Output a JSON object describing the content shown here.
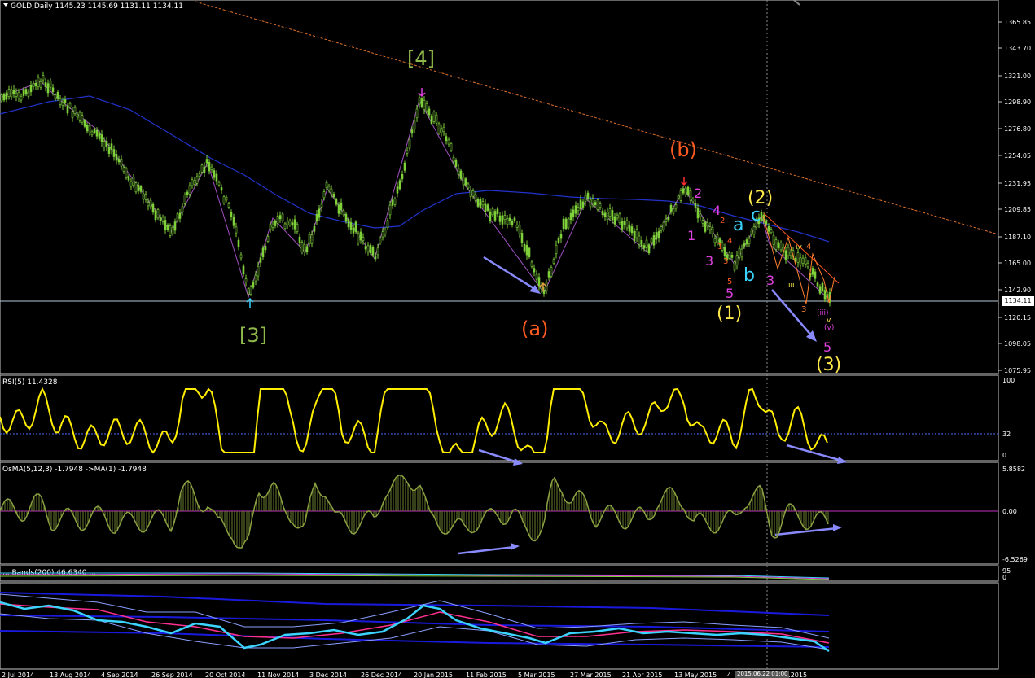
{
  "symbol_title": "GOLD,Daily  1145.23 1145.69 1131.11 1134.11",
  "current_price_label": "1134.11",
  "crosshair_date_label": "2015.06.22 01:00",
  "price_scale": [
    "1365.85",
    "1343.70",
    "1321.00",
    "1298.90",
    "1276.80",
    "1254.05",
    "1231.95",
    "1209.85",
    "1187.10",
    "1165.00",
    "1142.90",
    "1120.15",
    "1098.05",
    "1075.95"
  ],
  "rsi": {
    "title": "RSI(5) 11.4328",
    "scale": [
      "100",
      "32",
      "0"
    ]
  },
  "osma": {
    "title": "OsMA(5,12,3) -1.7948   ->MA(1) -1.7948",
    "scale": [
      "5.8582",
      "0.00",
      "-6.5269"
    ]
  },
  "strip": {
    "title": "... Bands(200) 46.6340 ...",
    "scale": [
      "95",
      "0"
    ]
  },
  "date_axis": [
    "2 Jul 2014",
    "13 Aug 2014",
    "4 Sep 2014",
    "26 Sep 2014",
    "20 Oct 2014",
    "11 Nov 2014",
    "3 Dec 2014",
    "26 Dec 2014",
    "20 Jan 2015",
    "11 Feb 2015",
    "5 Mar 2015",
    "27 Mar 2015",
    "21 Apr 2015",
    "13 May 2015",
    "4",
    "1 ..2015"
  ],
  "wave_labels": {
    "w3": "[3]",
    "w4": "[4]",
    "a": "(a)",
    "b": "(b)",
    "one": "(1)",
    "two": "(2)",
    "three": "(3)",
    "m1": "1",
    "m2": "2",
    "m3": "3",
    "m4": "4",
    "m5": "5",
    "sa": "a",
    "sb": "b",
    "sc": "c",
    "m3b": "3",
    "m5b": "5",
    "o1": "1",
    "o2": "2",
    "o3": "3",
    "o4": "4",
    "o5": "5",
    "r3": "3",
    "r4": "4",
    "riii": "iii",
    "riv": "iv",
    "piii": "(iii)",
    "pv": "(v)",
    "v": "v"
  },
  "colors": {
    "background": "#000000",
    "candles": "#7fd13b",
    "ma": "#2233cc",
    "trendline": "#e0702a",
    "rsi": "#ffee00",
    "osma": "#8aa040",
    "arrow": "#8a8aff",
    "wave_green": "#8fb84a",
    "wave_orange": "#ff5a1f",
    "wave_yellow": "#ffe84a",
    "wave_magenta": "#e040e0",
    "wave_cyan": "#3ad4ff"
  }
}
